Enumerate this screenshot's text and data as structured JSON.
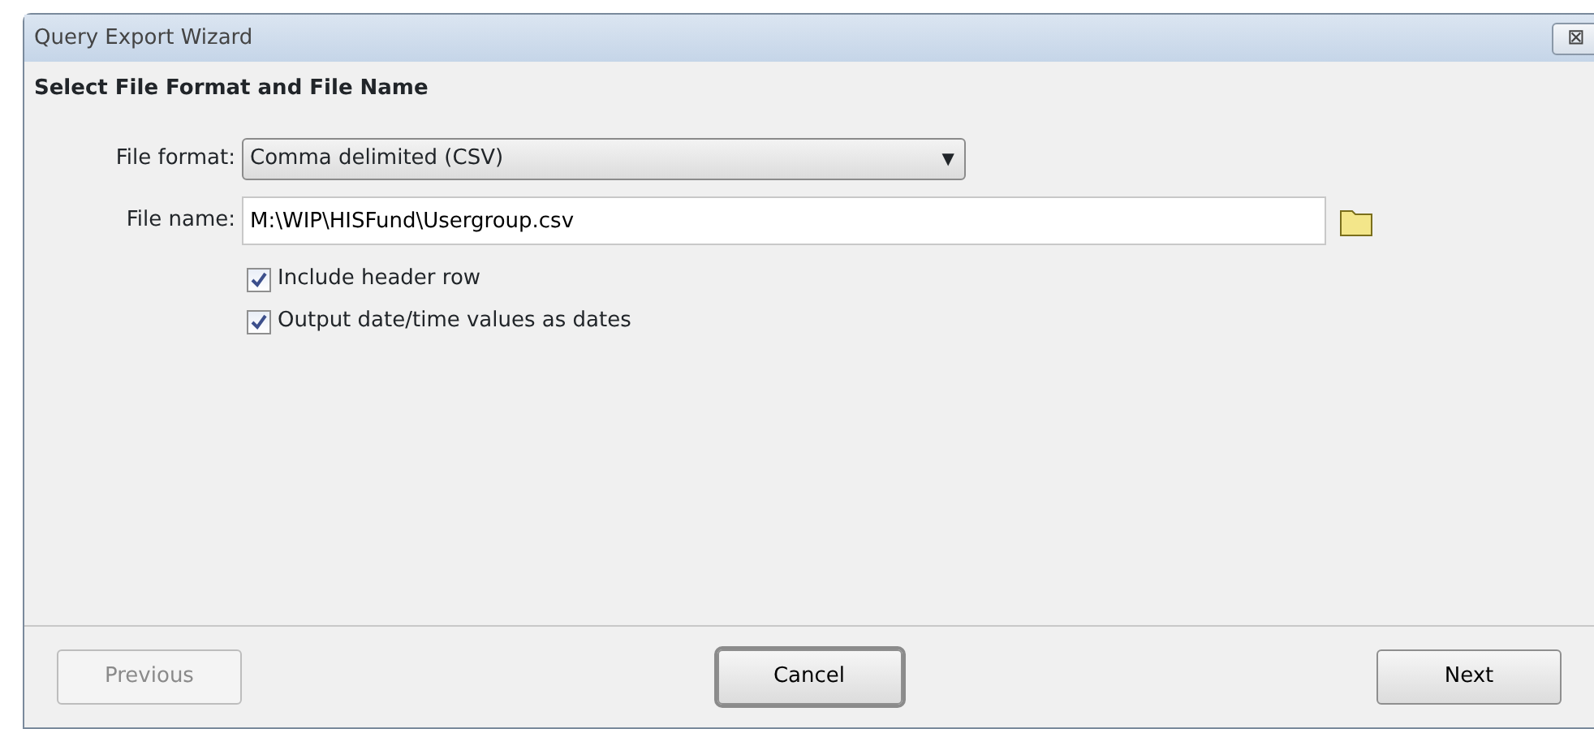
{
  "window": {
    "title": "Query Export Wizard",
    "close_glyph": "⊠"
  },
  "header": "Select File Format and File Name",
  "file_format": {
    "label": "File format:",
    "value": "Comma delimited (CSV)",
    "caret": "▼"
  },
  "file_name": {
    "label": "File name:",
    "value": "M:\\WIP\\HISFund\\Usergroup.csv"
  },
  "options": [
    {
      "label": "Include header row",
      "checked": true
    },
    {
      "label": "Output date/time values as dates",
      "checked": true
    }
  ],
  "buttons": [
    {
      "label": "Previous",
      "disabled": true,
      "focused": false
    },
    {
      "label": "Cancel",
      "disabled": false,
      "focused": true
    },
    {
      "label": "Next",
      "disabled": false,
      "focused": false
    }
  ]
}
